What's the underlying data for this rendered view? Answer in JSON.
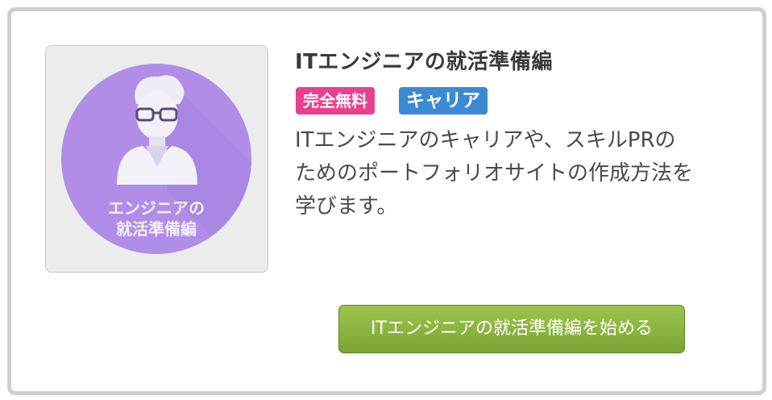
{
  "course": {
    "title": "ITエンジニアの就活準備編",
    "thumbnail": {
      "line1": "エンジニアの",
      "line2": "就活準備編",
      "circle_color": "#b08ee8"
    },
    "badges": {
      "free": "完全無料",
      "category": "キャリア"
    },
    "description": [
      "ITエンジニアのキャリアや、スキルPRの",
      "ためのポートフォリオサイトの作成方法を",
      "学びます。"
    ],
    "start_button": "ITエンジニアの就活準備編を始める"
  },
  "colors": {
    "badge_free": "#e8418e",
    "badge_category": "#3b8ad4",
    "button": "#8ab53f",
    "card_border": "#cfcfcf"
  },
  "icons": {
    "thumbnail_figure": "engineer-person-icon"
  }
}
